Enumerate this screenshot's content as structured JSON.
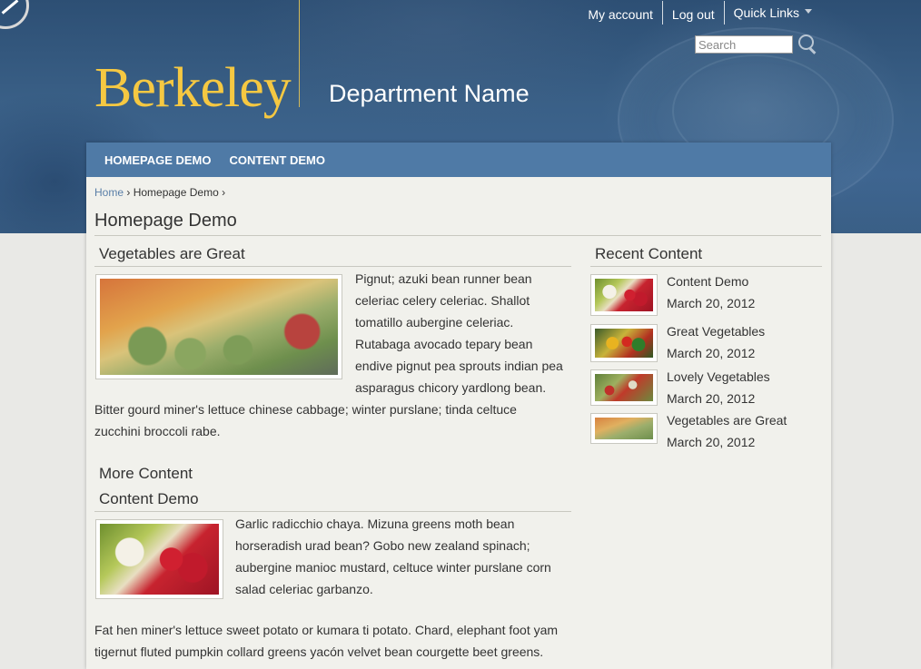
{
  "header": {
    "brand": "Berkeley",
    "department": "Department Name",
    "top_links": [
      "My account",
      "Log out",
      "Quick Links"
    ],
    "search_placeholder": "Search"
  },
  "nav": {
    "items": [
      "HOMEPAGE DEMO",
      "CONTENT DEMO"
    ]
  },
  "breadcrumb": {
    "home": "Home",
    "current": "Homepage Demo"
  },
  "page": {
    "title": "Homepage Demo"
  },
  "main": {
    "feature": {
      "title": "Vegetables are Great",
      "body_lines": [
        "Pignut; azuki bean runner bean",
        "celeriac celery celeriac. Shallot",
        "tomatillo aubergine celeriac.",
        "Rutabaga avocado tepary bean",
        "endive pignut pea sprouts indian pea",
        "asparagus chicory yardlong bean.",
        "Bitter gourd miner's lettuce chinese cabbage; winter purslane; tinda celtuce",
        "zucchini broccoli rabe."
      ]
    },
    "more": {
      "section_title": "More Content",
      "item_title": "Content Demo",
      "body_lines": [
        "Garlic radicchio chaya. Mizuna greens moth bean",
        "horseradish urad bean? Gobo new zealand spinach;",
        "aubergine manioc mustard, celtuce winter purslane corn",
        "salad celeriac garbanzo."
      ],
      "extra_lines": [
        "Fat hen miner's lettuce sweet potato or kumara ti potato. Chard, elephant foot yam",
        "tigernut fluted pumpkin collard greens yacón velvet bean courgette beet greens."
      ]
    }
  },
  "sidebar": {
    "title": "Recent Content",
    "items": [
      {
        "title": "Content Demo",
        "date": "March 20, 2012"
      },
      {
        "title": "Great Vegetables",
        "date": "March 20, 2012"
      },
      {
        "title": "Lovely Vegetables",
        "date": "March 20, 2012"
      },
      {
        "title": "Vegetables are Great",
        "date": "March 20, 2012"
      }
    ]
  }
}
